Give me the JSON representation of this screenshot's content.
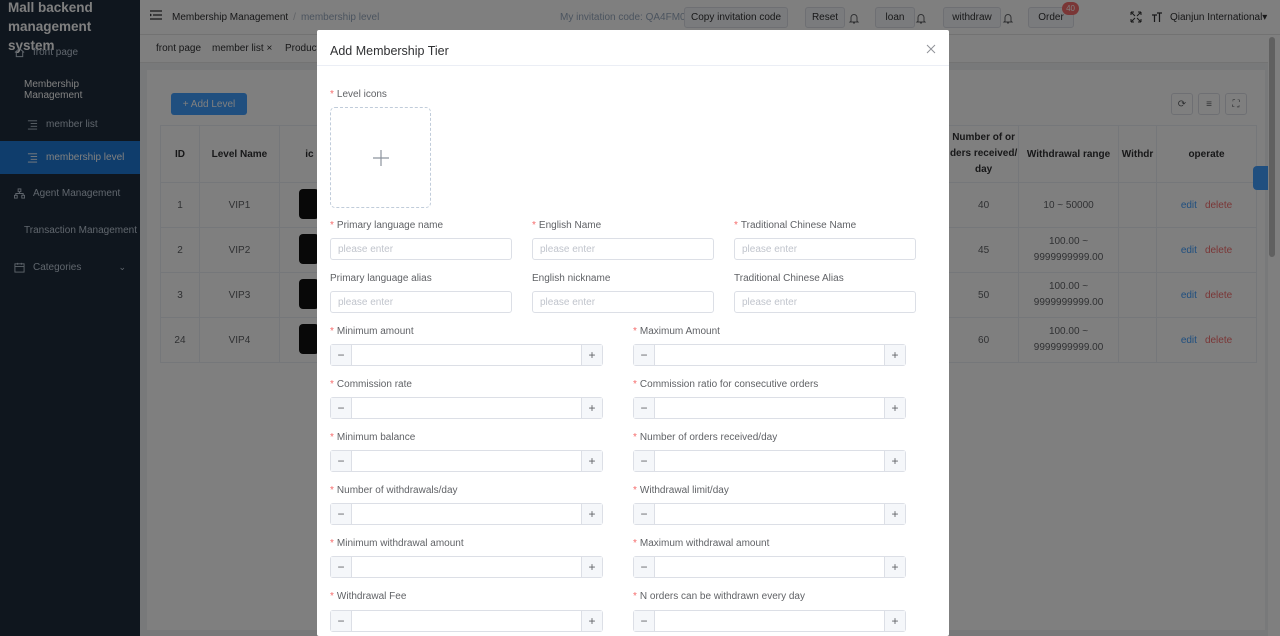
{
  "app": {
    "title": "Mall backend management system"
  },
  "sidebar": {
    "items": [
      {
        "label": "front page",
        "icon": "home-icon"
      },
      {
        "label": "Membership Management",
        "icon": ""
      },
      {
        "label": "member list",
        "icon": "list-icon"
      },
      {
        "label": "membership level",
        "icon": "list-icon"
      },
      {
        "label": "Agent Management",
        "icon": "sitemap-icon"
      },
      {
        "label": "Transaction Management",
        "icon": ""
      },
      {
        "label": "Categories",
        "icon": "calendar-icon"
      }
    ]
  },
  "header": {
    "breadcrumb": [
      "Membership Management",
      "membership level"
    ],
    "invitation_label": "My invitation code: QA4FM0",
    "copy_button": "Copy invitation code",
    "reset_button": "Reset",
    "loan_button": "loan",
    "withdraw_button": "withdraw",
    "order_button": "Order",
    "order_badge": "40",
    "user": "Qianjun International"
  },
  "tags": {
    "items": [
      "front page",
      "member list ×",
      "Product"
    ]
  },
  "toolbar": {
    "add_label": "+ Add Level"
  },
  "table": {
    "headers": [
      "ID",
      "Level Name",
      "ic",
      "Number of or ders received/ day",
      "Withdrawal range",
      "Withdr",
      "operate"
    ],
    "rows": [
      {
        "id": "1",
        "name": "VIP1",
        "orders": "40",
        "range": "10 ~ 50000"
      },
      {
        "id": "2",
        "name": "VIP2",
        "orders": "45",
        "range": "100.00 ~ 9999999999.00"
      },
      {
        "id": "3",
        "name": "VIP3",
        "orders": "50",
        "range": "100.00 ~ 9999999999.00"
      },
      {
        "id": "24",
        "name": "VIP4",
        "orders": "60",
        "range": "100.00 ~ 9999999999.00"
      }
    ],
    "edit_label": "edit",
    "delete_label": "delete"
  },
  "dialog": {
    "title": "Add Membership Tier",
    "level_icons": "Level icons",
    "placeholder": "please enter",
    "text_fields": [
      {
        "label": "Primary language name",
        "required": true
      },
      {
        "label": "English Name",
        "required": true
      },
      {
        "label": "Traditional Chinese Name",
        "required": true
      },
      {
        "label": "Primary language alias",
        "required": false
      },
      {
        "label": "English nickname",
        "required": false
      },
      {
        "label": "Traditional Chinese Alias",
        "required": false
      }
    ],
    "number_fields": [
      "Minimum amount",
      "Maximum Amount",
      "Commission rate",
      "Commission ratio for consecutive orders",
      "Minimum balance",
      "Number of orders received/day",
      "Number of withdrawals/day",
      "Withdrawal limit/day",
      "Minimum withdrawal amount",
      "Maximum withdrawal amount",
      "Withdrawal Fee",
      "N orders can be withdrawn every day"
    ]
  }
}
